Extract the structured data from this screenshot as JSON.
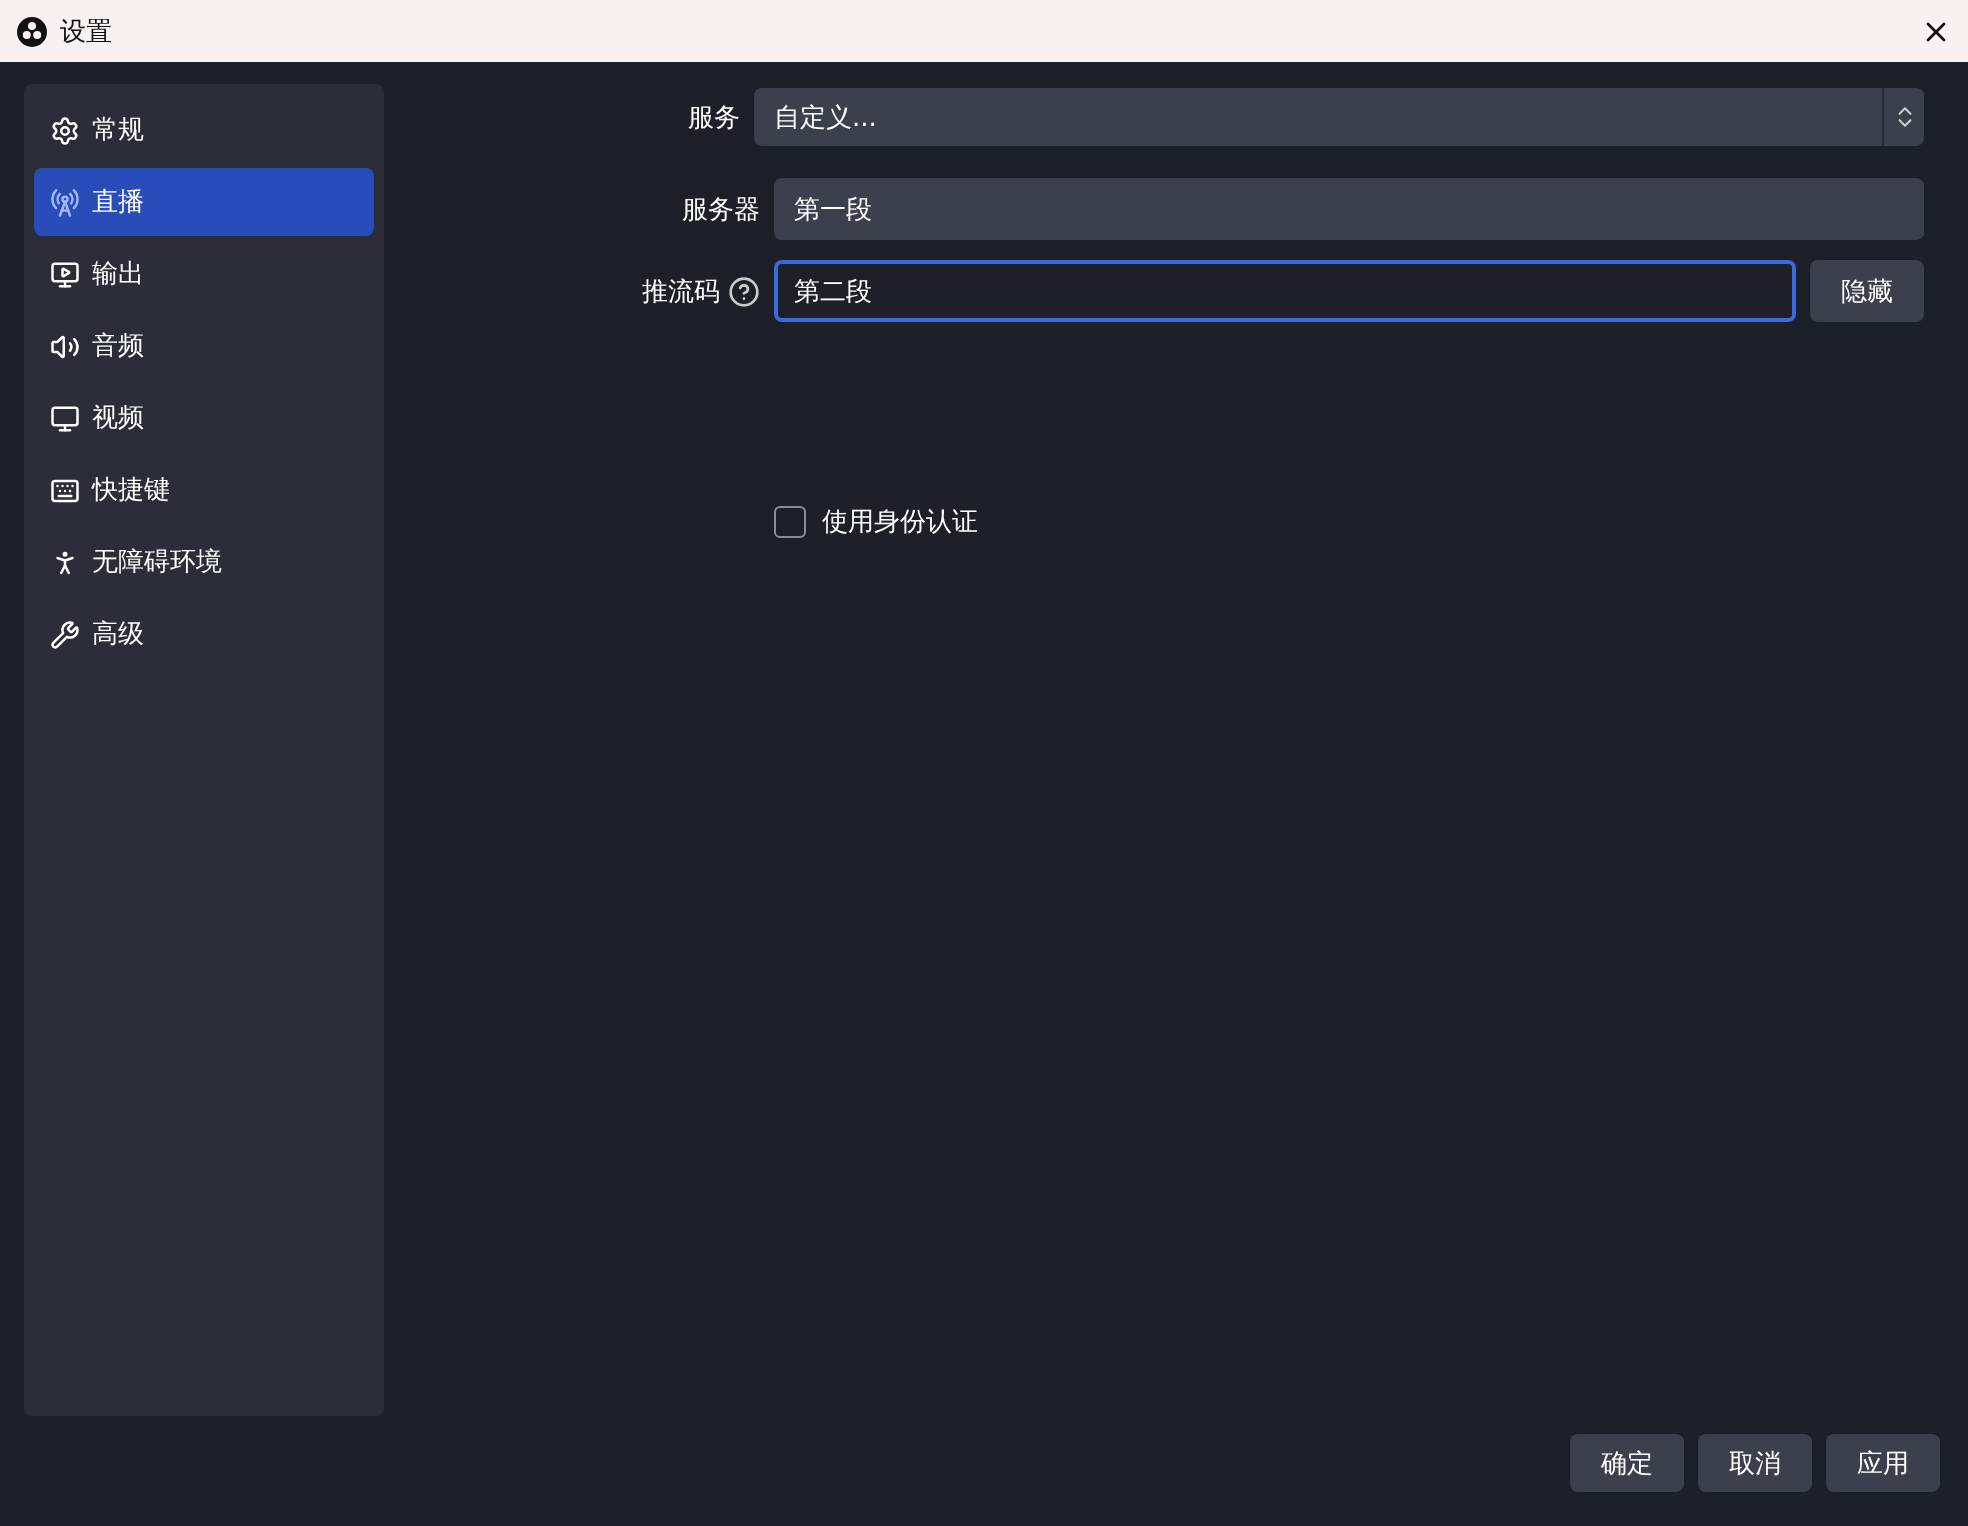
{
  "window": {
    "title": "设置"
  },
  "sidebar": {
    "items": [
      {
        "label": "常规",
        "selected": false
      },
      {
        "label": "直播",
        "selected": true
      },
      {
        "label": "输出",
        "selected": false
      },
      {
        "label": "音频",
        "selected": false
      },
      {
        "label": "视频",
        "selected": false
      },
      {
        "label": "快捷键",
        "selected": false
      },
      {
        "label": "无障碍环境",
        "selected": false
      },
      {
        "label": "高级",
        "selected": false
      }
    ]
  },
  "form": {
    "service": {
      "label": "服务",
      "value": "自定义..."
    },
    "server": {
      "label": "服务器",
      "value": "第一段"
    },
    "stream_key": {
      "label": "推流码",
      "value": "第二段",
      "focused": true,
      "button": "隐藏"
    },
    "use_auth": {
      "label": "使用身份认证",
      "checked": false
    }
  },
  "buttons": [
    "确定",
    "取消",
    "应用"
  ]
}
